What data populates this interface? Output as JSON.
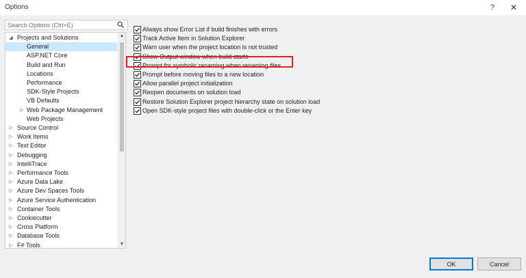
{
  "window": {
    "title": "Options",
    "help_glyph": "?",
    "close_glyph": "✕"
  },
  "search": {
    "placeholder": "Search Options (Ctrl+E)"
  },
  "tree": [
    {
      "label": "Projects and Solutions",
      "expanded": true
    },
    {
      "label": "General",
      "selected": true
    },
    {
      "label": "ASP.NET Core"
    },
    {
      "label": "Build and Run"
    },
    {
      "label": "Locations"
    },
    {
      "label": "Performance"
    },
    {
      "label": "SDK-Style Projects"
    },
    {
      "label": "VB Defaults"
    },
    {
      "label": "Web Package Management",
      "expanded": false
    },
    {
      "label": "Web Projects"
    },
    {
      "label": "Source Control",
      "expanded": false
    },
    {
      "label": "Work Items",
      "expanded": false
    },
    {
      "label": "Text Editor",
      "expanded": false
    },
    {
      "label": "Debugging",
      "expanded": false
    },
    {
      "label": "IntelliTrace",
      "expanded": false
    },
    {
      "label": "Performance Tools",
      "expanded": false
    },
    {
      "label": "Azure Data Lake",
      "expanded": false
    },
    {
      "label": "Azure Dev Spaces Tools",
      "expanded": false
    },
    {
      "label": "Azure Service Authentication",
      "expanded": false
    },
    {
      "label": "Container Tools",
      "expanded": false
    },
    {
      "label": "Cookiecutter",
      "expanded": false
    },
    {
      "label": "Cross Platform",
      "expanded": false
    },
    {
      "label": "Database Tools",
      "expanded": false
    },
    {
      "label": "F# Tools",
      "expanded": false
    }
  ],
  "options": [
    {
      "label": "Always show Error List if build finishes with errors",
      "checked": true
    },
    {
      "label": "Track Active Item in Solution Explorer",
      "checked": true
    },
    {
      "label": "Warn user when the project location is not trusted",
      "checked": true
    },
    {
      "label": "Show Output window when build starts",
      "checked": true,
      "highlighted": true
    },
    {
      "label": "Prompt for symbolic renaming when renaming files",
      "checked": true
    },
    {
      "label": "Prompt before moving files to a new location",
      "checked": true
    },
    {
      "label": "Allow parallel project initialization",
      "checked": true
    },
    {
      "label": "Reopen documents on solution load",
      "checked": true
    },
    {
      "label": "Restore Solution Explorer project hierarchy state on solution load",
      "checked": true
    },
    {
      "label": "Open SDK-style project files with double-click or the Enter key",
      "checked": true
    }
  ],
  "buttons": {
    "ok": "OK",
    "cancel": "Cancel"
  },
  "colors": {
    "selection": "#cce8ff",
    "highlight_box": "#e21f1f",
    "ok_border": "#0078d7"
  }
}
